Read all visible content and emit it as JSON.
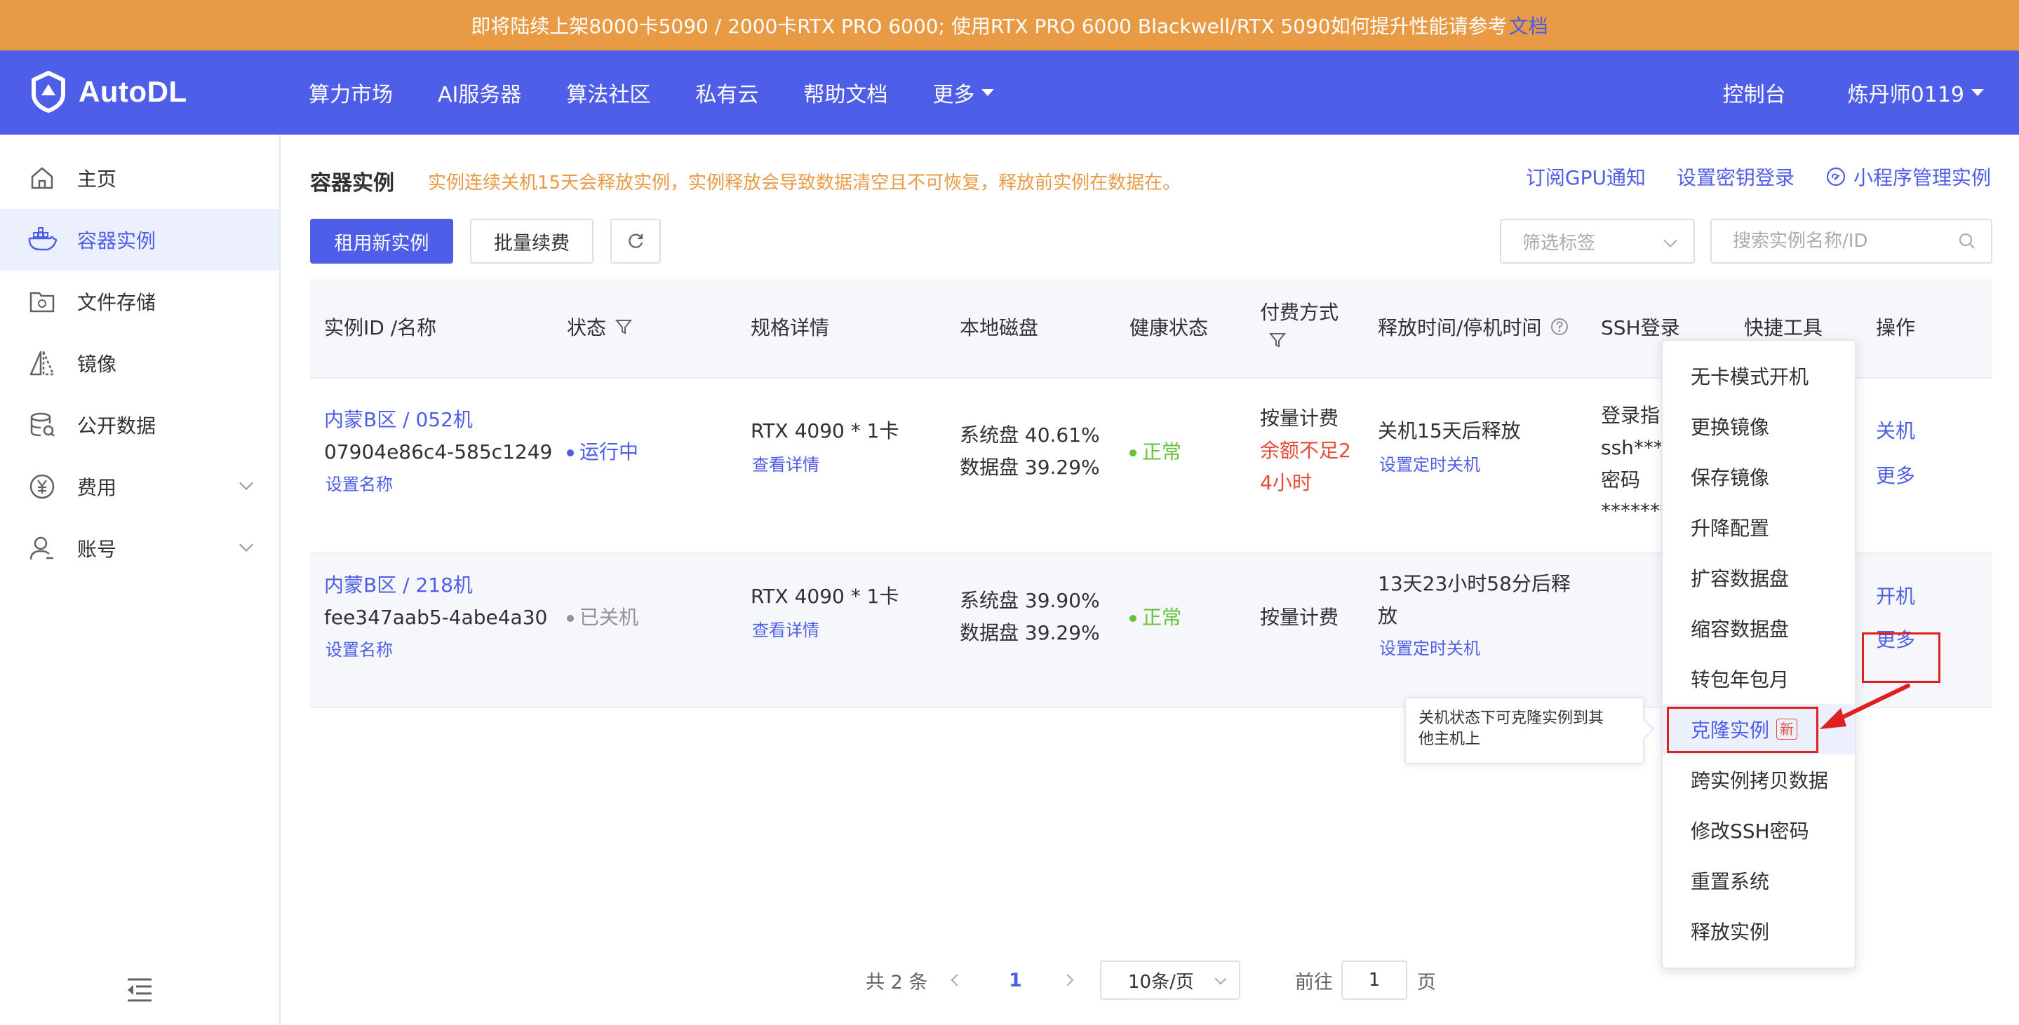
{
  "banner": {
    "text": "即将陆续上架8000卡5090 / 2000卡RTX PRO 6000; 使用RTX PRO 6000 Blackwell/RTX 5090如何提升性能请参考",
    "link": "文档"
  },
  "header": {
    "brand": "AutoDL",
    "nav": [
      "算力市场",
      "AI服务器",
      "算法社区",
      "私有云",
      "帮助文档",
      "更多"
    ],
    "console": "控制台",
    "user": "炼丹师0119"
  },
  "sidebar": {
    "items": [
      {
        "label": "主页",
        "icon": "home-icon"
      },
      {
        "label": "容器实例",
        "icon": "container-icon"
      },
      {
        "label": "文件存储",
        "icon": "folder-icon"
      },
      {
        "label": "镜像",
        "icon": "image-icon"
      },
      {
        "label": "公开数据",
        "icon": "database-icon"
      },
      {
        "label": "费用",
        "icon": "yen-icon"
      },
      {
        "label": "账号",
        "icon": "user-icon"
      }
    ]
  },
  "main": {
    "title": "容器实例",
    "notice": "实例连续关机15天会释放实例，实例释放会导致数据清空且不可恢复，释放前实例在数据在。",
    "links": [
      "订阅GPU通知",
      "设置密钥登录",
      "小程序管理实例"
    ],
    "buttons": {
      "rent": "租用新实例",
      "renew": "批量续费"
    },
    "filter_placeholder": "筛选标签",
    "search_placeholder": "搜索实例名称/ID"
  },
  "table": {
    "columns": [
      "实例ID /名称",
      "状态",
      "规格详情",
      "本地磁盘",
      "健康状态",
      "付费方式",
      "释放时间/停机时间",
      "SSH登录",
      "快捷工具",
      "操作"
    ],
    "rows": [
      {
        "region": "内蒙B区 / 052机",
        "id": "07904e86c4-585c1249",
        "set_name": "设置名称",
        "status": "运行中",
        "spec": "RTX 4090 * 1卡",
        "spec_link": "查看详情",
        "disk_sys": "系统盘 40.61%",
        "disk_data": "数据盘 39.29%",
        "health": "正常",
        "pay": "按量计费",
        "pay_warn_1": "余额不足2",
        "pay_warn_2": "4小时",
        "release": "关机15天后释放",
        "release_link": "设置定时关机",
        "ssh_1": "登录指",
        "ssh_2": "ssh****",
        "ssh_3": "密码",
        "ssh_4": "********",
        "action_1": "关机",
        "action_2": "更多"
      },
      {
        "region": "内蒙B区 / 218机",
        "id": "fee347aab5-4abe4a30",
        "set_name": "设置名称",
        "status": "已关机",
        "spec": "RTX 4090 * 1卡",
        "spec_link": "查看详情",
        "disk_sys": "系统盘 39.90%",
        "disk_data": "数据盘 39.29%",
        "health": "正常",
        "pay": "按量计费",
        "release_1": "13天23小时58分后释",
        "release_2": "放",
        "release_link": "设置定时关机",
        "action_1": "开机",
        "action_2": "更多"
      }
    ]
  },
  "pagination": {
    "total": "共 2 条",
    "current": "1",
    "page_size": "10条/页",
    "goto": "前往",
    "goto_value": "1",
    "page": "页"
  },
  "dropdown": {
    "items": [
      "无卡模式开机",
      "更换镜像",
      "保存镜像",
      "升降配置",
      "扩容数据盘",
      "缩容数据盘",
      "转包年包月",
      "克隆实例",
      "跨实例拷贝数据",
      "修改SSH密码",
      "重置系统",
      "释放实例"
    ],
    "badge": "新"
  },
  "tooltip": {
    "line1": "关机状态下可克隆实例到其",
    "line2": "他主机上"
  },
  "colors": {
    "brand": "#4E5EE9",
    "banner": "#E99A45",
    "warning": "#E64A3B",
    "success": "#67C23A",
    "annotation": "#E02020"
  }
}
